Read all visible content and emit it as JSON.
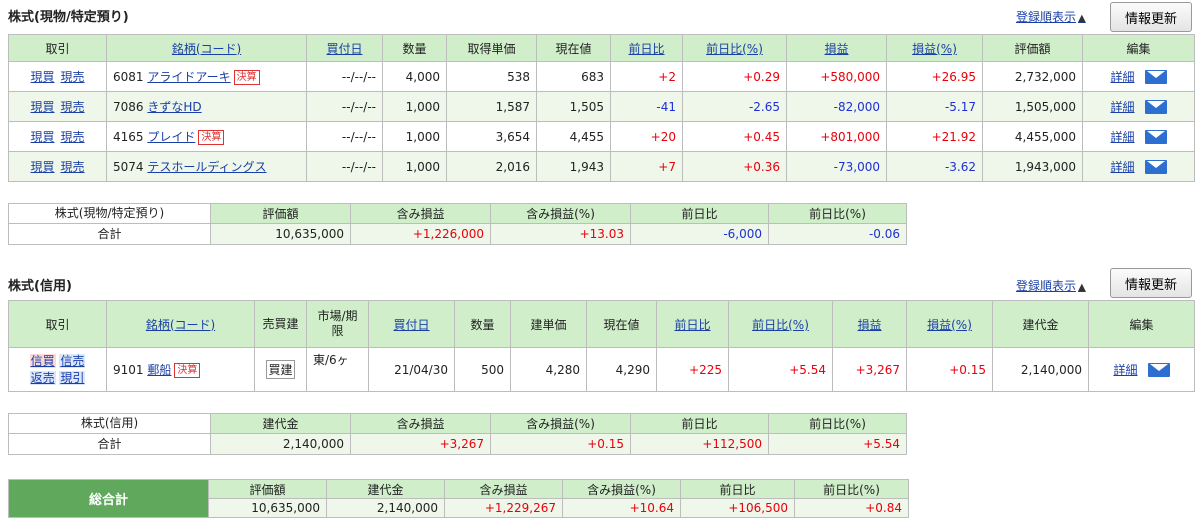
{
  "genbutsu": {
    "title": "株式(現物/特定預り)",
    "sort_label": "登録順表示",
    "refresh_label": "情報更新",
    "headers": [
      "取引",
      "銘柄(コード)",
      "買付日",
      "数量",
      "取得単価",
      "現在値",
      "前日比",
      "前日比(%)",
      "損益",
      "損益(%)",
      "評価額",
      "編集"
    ],
    "actions": [
      "現買",
      "現売"
    ],
    "detail_label": "詳細",
    "rows": [
      {
        "code": "6081",
        "name": "アライドアーキ",
        "badge": "決算",
        "date": "--/--/--",
        "qty": "4,000",
        "cost": "538",
        "price": "683",
        "chg": "+2",
        "chg_pct": "+0.29",
        "pl": "+580,000",
        "pl_pct": "+26.95",
        "value": "2,732,000"
      },
      {
        "code": "7086",
        "name": "きずなHD",
        "badge": "",
        "date": "--/--/--",
        "qty": "1,000",
        "cost": "1,587",
        "price": "1,505",
        "chg": "-41",
        "chg_pct": "-2.65",
        "pl": "-82,000",
        "pl_pct": "-5.17",
        "value": "1,505,000"
      },
      {
        "code": "4165",
        "name": "プレイド",
        "badge": "決算",
        "date": "--/--/--",
        "qty": "1,000",
        "cost": "3,654",
        "price": "4,455",
        "chg": "+20",
        "chg_pct": "+0.45",
        "pl": "+801,000",
        "pl_pct": "+21.92",
        "value": "4,455,000"
      },
      {
        "code": "5074",
        "name": "テスホールディングス",
        "badge": "",
        "date": "--/--/--",
        "qty": "1,000",
        "cost": "2,016",
        "price": "1,943",
        "chg": "+7",
        "chg_pct": "+0.36",
        "pl": "-73,000",
        "pl_pct": "-3.62",
        "value": "1,943,000"
      }
    ],
    "summary": {
      "label1": "株式(現物/特定預り)",
      "label2": "合計",
      "headers": [
        "評価額",
        "含み損益",
        "含み損益(%)",
        "前日比",
        "前日比(%)"
      ],
      "values": [
        "10,635,000",
        "+1,226,000",
        "+13.03",
        "-6,000",
        "-0.06"
      ]
    }
  },
  "shinyo": {
    "title": "株式(信用)",
    "sort_label": "登録順表示",
    "refresh_label": "情報更新",
    "headers": [
      "取引",
      "銘柄(コード)",
      "売買建",
      "市場/期限",
      "買付日",
      "数量",
      "建単価",
      "現在値",
      "前日比",
      "前日比(%)",
      "損益",
      "損益(%)",
      "建代金",
      "編集"
    ],
    "actions": [
      "信買",
      "信売",
      "返売",
      "現引"
    ],
    "detail_label": "詳細",
    "row": {
      "code": "9101",
      "name": "郵船",
      "badge": "決算",
      "type": "買建",
      "market": "東/6ヶ",
      "date": "21/04/30",
      "qty": "500",
      "cost": "4,280",
      "price": "4,290",
      "chg": "+225",
      "chg_pct": "+5.54",
      "pl": "+3,267",
      "pl_pct": "+0.15",
      "value": "2,140,000"
    },
    "summary": {
      "label1": "株式(信用)",
      "label2": "合計",
      "headers": [
        "建代金",
        "含み損益",
        "含み損益(%)",
        "前日比",
        "前日比(%)"
      ],
      "values": [
        "2,140,000",
        "+3,267",
        "+0.15",
        "+112,500",
        "+5.54"
      ]
    }
  },
  "grand": {
    "label": "総合計",
    "headers": [
      "評価額",
      "建代金",
      "含み損益",
      "含み損益(%)",
      "前日比",
      "前日比(%)"
    ],
    "values": [
      "10,635,000",
      "2,140,000",
      "+1,229,267",
      "+10.64",
      "+106,500",
      "+0.84"
    ]
  },
  "colors": {
    "header_bg": "#cfeec9",
    "row_alt": "#eef7ea",
    "positive": "#e8000b",
    "negative": "#1f2fd4",
    "grand_label": "#5fa85c"
  }
}
